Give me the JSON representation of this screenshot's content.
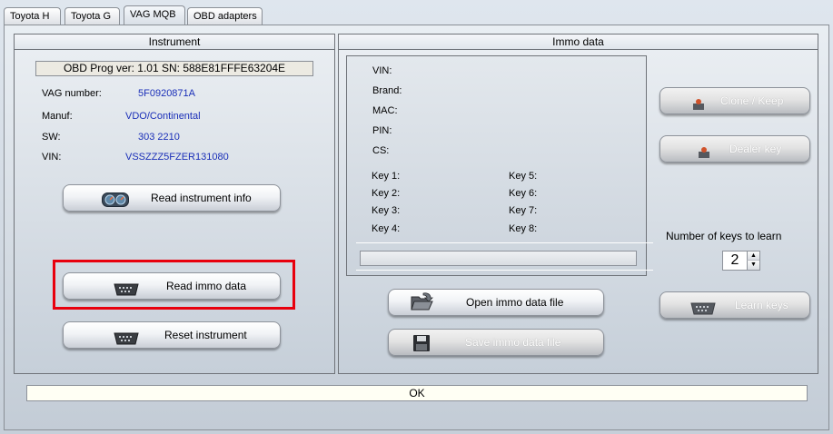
{
  "tabs": [
    {
      "label": "Toyota H"
    },
    {
      "label": "Toyota G"
    },
    {
      "label": "VAG MQB"
    },
    {
      "label": "OBD adapters"
    }
  ],
  "instrument": {
    "title": "Instrument",
    "version": "OBD Prog ver: 1.01  SN: 588E81FFFE63204E",
    "fields": [
      {
        "label": "VAG number:",
        "value": "5F0920871A"
      },
      {
        "label": "Manuf:",
        "value": "VDO/Continental"
      },
      {
        "label": "SW:",
        "value": "303 2210"
      },
      {
        "label": "VIN:",
        "value": "VSSZZZ5FZER131080"
      }
    ],
    "read_info_button": "Read instrument info",
    "read_immo_button": "Read immo data",
    "reset_button": "Reset instrument"
  },
  "immo": {
    "title": "Immo data",
    "labels": {
      "vin": "VIN:",
      "brand": "Brand:",
      "mac": "MAC:",
      "pin": "PIN:",
      "cs": "CS:"
    },
    "keys": [
      "Key 1:",
      "Key 2:",
      "Key 3:",
      "Key 4:",
      "Key 5:",
      "Key 6:",
      "Key 7:",
      "Key 8:"
    ],
    "open_button": "Open immo data file",
    "save_button": "Save immo data file",
    "clone_button": "Clone / Keep",
    "dealer_button": "Dealer key",
    "num_keys_label": "Number of keys to learn",
    "num_keys_value": "2",
    "learn_button": "Learn keys"
  },
  "status": {
    "text": "OK"
  }
}
